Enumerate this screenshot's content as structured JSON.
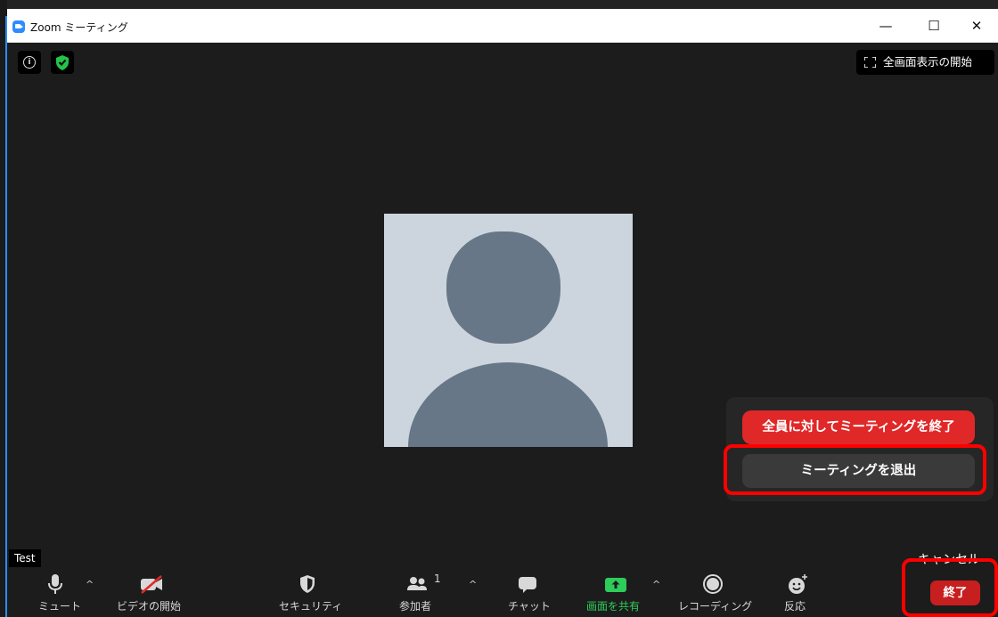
{
  "window": {
    "title": "Zoom ミーティング",
    "minimize_glyph": "—",
    "maximize_glyph": "☐",
    "close_glyph": "✕"
  },
  "top": {
    "info_icon_glyph": "i",
    "fullscreen_label": "全画面表示の開始"
  },
  "participant": {
    "name": "Test"
  },
  "end_menu": {
    "end_for_all": "全員に対してミーティングを終了",
    "leave": "ミーティングを退出",
    "cancel": "キャンセル"
  },
  "toolbar": {
    "mute": "ミュート",
    "start_video": "ビデオの開始",
    "security": "セキュリティ",
    "participants": "参加者",
    "participants_count": "1",
    "chat": "チャット",
    "share_screen": "画面を共有",
    "recording": "レコーディング",
    "reactions": "反応",
    "end": "終了",
    "caret": "^"
  },
  "colors": {
    "meeting_bg": "#1c1c1c",
    "zoom_blue": "#2d8cff",
    "end_red": "#e02828",
    "share_green": "#2ecc5a",
    "highlight_red": "#ff0000",
    "avatar_bg": "#ccd5dd",
    "avatar_fg": "#677787"
  },
  "icons": {
    "app": "zoom-logo-icon",
    "info": "info-icon",
    "security": "shield-check-icon",
    "fullscreen": "fullscreen-icon",
    "mute": "microphone-icon",
    "video": "video-off-icon",
    "security_tb": "shield-icon",
    "participants": "people-icon",
    "chat": "chat-bubble-icon",
    "share": "share-screen-icon",
    "record": "record-icon",
    "reactions": "emoji-add-icon"
  }
}
